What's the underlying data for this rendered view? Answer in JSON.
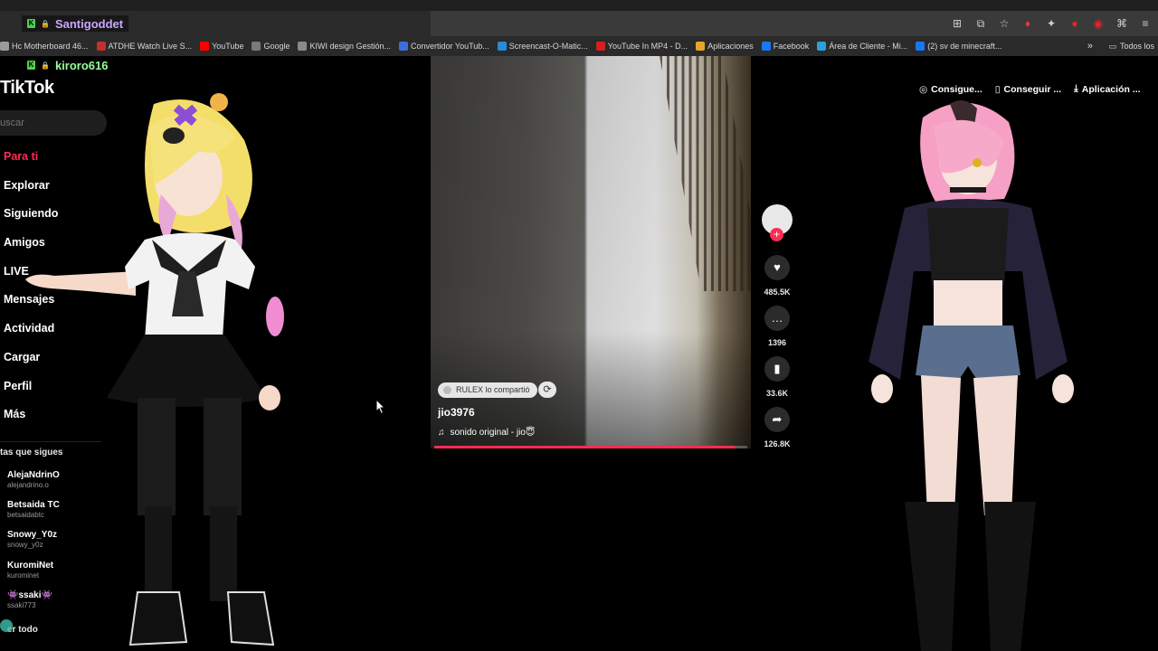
{
  "chat_users": [
    {
      "name": "Santigoddet"
    },
    {
      "name": "kiroro616"
    }
  ],
  "bookmarks": {
    "items": [
      {
        "label": "Hc Motherboard 46...",
        "color": "#9b9b9b"
      },
      {
        "label": "ATDHE Watch Live S...",
        "color": "#c2302f"
      },
      {
        "label": "YouTube",
        "color": "#ff0000"
      },
      {
        "label": "Google",
        "color": "#7a7a7a"
      },
      {
        "label": "KIWI design Gestión...",
        "color": "#8a8a8a"
      },
      {
        "label": "Convertidor YouTub...",
        "color": "#3b6fd8"
      },
      {
        "label": "Screencast-O-Matic...",
        "color": "#2b8ad6"
      },
      {
        "label": "YouTube In MP4 - D...",
        "color": "#d62020"
      },
      {
        "label": "Aplicaciones",
        "color": "#e5a52c"
      },
      {
        "label": "Facebook",
        "color": "#1877f2"
      },
      {
        "label": "Área de Cliente - Mi...",
        "color": "#2aa0d8"
      },
      {
        "label": "(2) sv de minecraft...",
        "color": "#1877f2"
      }
    ],
    "more": "»",
    "all_label": "Todos los"
  },
  "tiktok": {
    "logo": "TikTok",
    "search_placeholder": "uscar",
    "nav": [
      {
        "label": "Para ti",
        "active": true
      },
      {
        "label": "Explorar"
      },
      {
        "label": "Siguiendo"
      },
      {
        "label": "Amigos"
      },
      {
        "label": "LIVE"
      },
      {
        "label": "Mensajes"
      },
      {
        "label": "Actividad"
      },
      {
        "label": "Cargar"
      },
      {
        "label": "Perfil"
      },
      {
        "label": "Más"
      }
    ],
    "following_header": "tas que sigues",
    "following": [
      {
        "name": "AlejaNdrinO",
        "handle": "alejandrino.o"
      },
      {
        "name": "Betsaida TC",
        "handle": "betsaidabtc"
      },
      {
        "name": "Snowy_Y0z",
        "handle": "snowy_y0z"
      },
      {
        "name": "KuromiNet",
        "handle": "kurominet"
      },
      {
        "name": "👾ssaki👾",
        "handle": "ssaki773"
      }
    ],
    "see_all": "er todo",
    "header_actions": [
      {
        "icon": "coin-icon",
        "label": "Consigue..."
      },
      {
        "icon": "phone-icon",
        "label": "Conseguir ..."
      },
      {
        "icon": "download-icon",
        "label": "Aplicación ..."
      }
    ]
  },
  "video": {
    "shared_by": "RULEX lo compartió",
    "author": "jio3976",
    "music": "sonido original - jio😇",
    "progress": 0.96,
    "likes": "485.5K",
    "comments": "1396",
    "saves": "33.6K",
    "shares": "126.8K"
  },
  "colors": {
    "accent": "#fe2c55",
    "chat_name_1": "#cda6ff",
    "chat_name_2": "#99ff99"
  }
}
